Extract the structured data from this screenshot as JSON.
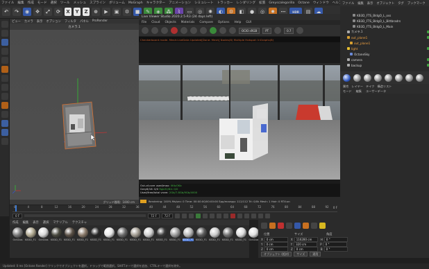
{
  "menubar": [
    "ファイル",
    "編集",
    "作成",
    "モード",
    "選択",
    "ツール",
    "メッシュ",
    "スプライン",
    "ボリューム",
    "MoGraph",
    "キャラクター",
    "アニメーション",
    "シミュレート",
    "トラッカー",
    "レンダリング",
    "拡張",
    "Greyscalegorilla",
    "Octane",
    "ウィンドウ",
    "ヘルプ",
    "RenderCMS",
    "ノードスペース"
  ],
  "toolbar": {
    "x": "X",
    "y": "Y",
    "z": "Z"
  },
  "viewport": {
    "menu": [
      "ビュー",
      "カメラ",
      "表示",
      "オプション",
      "フィルタ",
      "パネル",
      "ProRender"
    ],
    "camera": "カメラ.1",
    "grid_status": "グリッド間隔：1000 cm"
  },
  "live_viewer": {
    "title": "Live Viewer Studio 2020.2.5-R3 (24 days left)",
    "menu": [
      "File",
      "Cloud",
      "Objects",
      "Materials",
      "Compare",
      "Options",
      "Help",
      "GUI"
    ],
    "colorspace": "OCIO sRGB",
    "mode": "PT",
    "value": "0.7",
    "info": "Checkerboard mode. Mesh:LiveData Updated[Done: Mesh] Nodes(8) Multiple Hotspot: InGraphs(8)",
    "stats": [
      {
        "label": "Out-of-core used/max:",
        "value": "0Kb/0Kb"
      },
      {
        "label": "Grey8/16: 0/0",
        "value": "Rgb32/64: 0/0"
      },
      {
        "label": "Used/free/total vram:",
        "value": "2Gb/7.8Gb/9Gb/4000"
      }
    ],
    "rendering": "Rendering: 100%  Ms/sec: 0  Time: 00:00:00/00:00:00  Spp/maxspp: 112/112  Tri: 0/0k  Mesh: 1  Hair: 0  RTX:on"
  },
  "object_manager": {
    "menu": [
      "ファイル",
      "編集",
      "表示",
      "オブジェクト",
      "タグ",
      "ブックマーク"
    ],
    "items": [
      {
        "label": "KB3D_FTS_BldgO_L_oss",
        "selected": false
      },
      {
        "label": "KB3D_FTS_BldgO_L_Bittbradrs",
        "selected": false
      },
      {
        "label": "KB3D_FTS_BldgO_L_Main",
        "selected": false
      },
      {
        "label": "カメラ.1",
        "selected": false
      },
      {
        "label": "out_plane1",
        "selected": true
      },
      {
        "label": "out_plane1",
        "selected": true
      },
      {
        "label": "light",
        "selected": true
      },
      {
        "label": "OctaneSky",
        "selected": false
      },
      {
        "label": "camera",
        "selected": false
      },
      {
        "label": "backup",
        "selected": false
      }
    ]
  },
  "attributes": {
    "tabs": [
      "属性",
      "レイヤー",
      "テイク",
      "構造リスト"
    ],
    "menu": [
      "モード",
      "編集",
      "ユーザーデータ"
    ]
  },
  "timeline": {
    "ticks": [
      "0",
      "4",
      "8",
      "12",
      "16",
      "20",
      "24",
      "28",
      "32",
      "36",
      "40",
      "44",
      "48",
      "52",
      "56",
      "60",
      "64",
      "68",
      "72",
      "76",
      "80",
      "84",
      "88",
      "92"
    ],
    "current_frame": "0 F",
    "start": "0 F",
    "end": "72 F",
    "end2": "72 F",
    "frame_right": "0 F"
  },
  "materials": {
    "menu": [
      "作成",
      "編集",
      "表示",
      "選択",
      "マテリアル",
      "テクスチャ"
    ],
    "items": [
      {
        "label": "OctGlos",
        "color": "#7a7a7a"
      },
      {
        "label": "KB3D_F1",
        "color": "#b0a890"
      },
      {
        "label": "OctGlos",
        "color": "#d8d8d8"
      },
      {
        "label": "KB3D_F1",
        "color": "#4a4a40"
      },
      {
        "label": "KB3D_F1",
        "color": "#5a5046"
      },
      {
        "label": "KB3D_F1",
        "color": "#8a7a6a"
      },
      {
        "label": "KB3D_F1",
        "color": "#2a2a2a"
      },
      {
        "label": "KB3D_F1",
        "color": "#e8e8e8"
      },
      {
        "label": "KB3D_F1",
        "color": "#6a6a6a"
      },
      {
        "label": "KB3D_F1",
        "color": "#a09a90"
      },
      {
        "label": "KB3D_F1",
        "color": "#cfcfcf"
      },
      {
        "label": "KB3D_F1",
        "color": "#3a3a3a"
      },
      {
        "label": "KB3D_F1",
        "color": "#9a9a9a"
      },
      {
        "label": "KB3D_F1",
        "color": "#b8b8b8"
      },
      {
        "label": "KB3D_F1",
        "color": "#5c5c5c"
      },
      {
        "label": "KB3D_F1",
        "color": "#cacaca"
      },
      {
        "label": "KB3D_F1",
        "color": "#707070"
      },
      {
        "label": "KB3D_F1",
        "color": "#dcdcdc"
      },
      {
        "label": "OctGlos",
        "color": "#e0e0e0"
      },
      {
        "label": "OctDiffu",
        "color": "#ffffff"
      }
    ]
  },
  "coordinates": {
    "headers": [
      "位置",
      "サイズ",
      "角度"
    ],
    "rows": [
      {
        "axis": "X",
        "pos": "0 cm",
        "size": "116280 cm",
        "angle": "H",
        "angle_val": "0 °"
      },
      {
        "axis": "Y",
        "pos": "0 cm",
        "size": "320 cm",
        "angle": "P",
        "angle_val": "0 °"
      },
      {
        "axis": "Z",
        "pos": "0 cm",
        "size": "0 cm",
        "angle": "B",
        "angle_val": "0 °"
      }
    ],
    "mode": "オブジェクト (相対)",
    "size_mode": "サイズ",
    "apply": "適用"
  },
  "statusbar": "Updated: 0 ms  [Octane Render] クリックでオブジェクトを選択。ドラッグで範囲選択。SHIFTキーで選択を追加、CTRLキーで選択を除外。"
}
